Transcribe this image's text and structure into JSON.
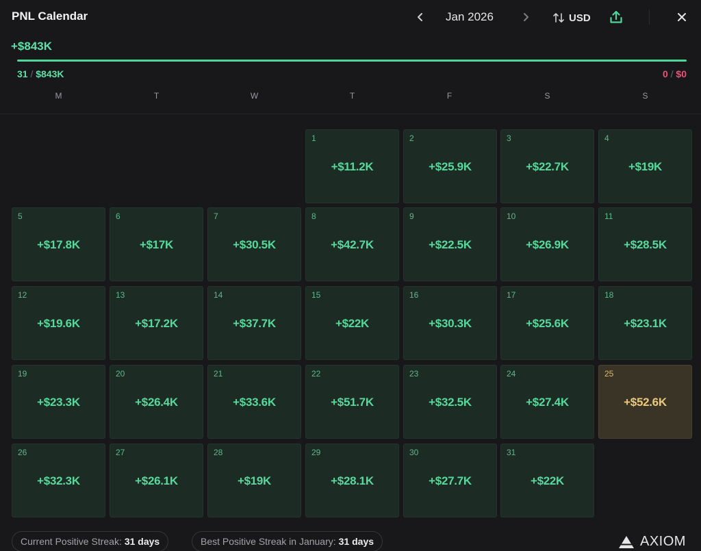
{
  "header": {
    "title": "PNL Calendar",
    "month": "Jan 2026",
    "currency": "USD",
    "prev_icon": "chevron-left-icon",
    "next_icon": "chevron-right-icon",
    "sort_icon": "sort-arrows-icon",
    "share_icon": "share-upload-icon",
    "close_icon": "close-icon"
  },
  "summary": {
    "total": "+$843K",
    "positive_days": "31",
    "positive_sep": "/",
    "positive_amount": "$843K",
    "negative_days": "0",
    "negative_sep": "/",
    "negative_amount": "$0",
    "progress_positive_fraction": 1.0
  },
  "colors": {
    "positive": "#5fe0a8",
    "negative": "#f0507a",
    "best_day": "#ecc97a",
    "background": "#18181b"
  },
  "weekdays": [
    "M",
    "T",
    "W",
    "T",
    "F",
    "S",
    "S"
  ],
  "days": [
    {
      "day": "1",
      "value": "+$11.2K"
    },
    {
      "day": "2",
      "value": "+$25.9K"
    },
    {
      "day": "3",
      "value": "+$22.7K"
    },
    {
      "day": "4",
      "value": "+$19K"
    },
    {
      "day": "5",
      "value": "+$17.8K"
    },
    {
      "day": "6",
      "value": "+$17K"
    },
    {
      "day": "7",
      "value": "+$30.5K"
    },
    {
      "day": "8",
      "value": "+$42.7K"
    },
    {
      "day": "9",
      "value": "+$22.5K"
    },
    {
      "day": "10",
      "value": "+$26.9K"
    },
    {
      "day": "11",
      "value": "+$28.5K"
    },
    {
      "day": "12",
      "value": "+$19.6K"
    },
    {
      "day": "13",
      "value": "+$17.2K"
    },
    {
      "day": "14",
      "value": "+$37.7K"
    },
    {
      "day": "15",
      "value": "+$22K"
    },
    {
      "day": "16",
      "value": "+$30.3K"
    },
    {
      "day": "17",
      "value": "+$25.6K"
    },
    {
      "day": "18",
      "value": "+$23.1K"
    },
    {
      "day": "19",
      "value": "+$23.3K"
    },
    {
      "day": "20",
      "value": "+$26.4K"
    },
    {
      "day": "21",
      "value": "+$33.6K"
    },
    {
      "day": "22",
      "value": "+$51.7K"
    },
    {
      "day": "23",
      "value": "+$32.5K"
    },
    {
      "day": "24",
      "value": "+$27.4K"
    },
    {
      "day": "25",
      "value": "+$52.6K",
      "best": true
    },
    {
      "day": "26",
      "value": "+$32.3K"
    },
    {
      "day": "27",
      "value": "+$26.1K"
    },
    {
      "day": "28",
      "value": "+$19K"
    },
    {
      "day": "29",
      "value": "+$28.1K"
    },
    {
      "day": "30",
      "value": "+$27.7K"
    },
    {
      "day": "31",
      "value": "+$22K"
    }
  ],
  "footer": {
    "streak_label": "Current Positive Streak:",
    "streak_value": "31 days",
    "best_label": "Best Positive Streak in January:",
    "best_value": "31 days",
    "brand": "AXIOM",
    "brand_icon": "axiom-logo-icon"
  }
}
